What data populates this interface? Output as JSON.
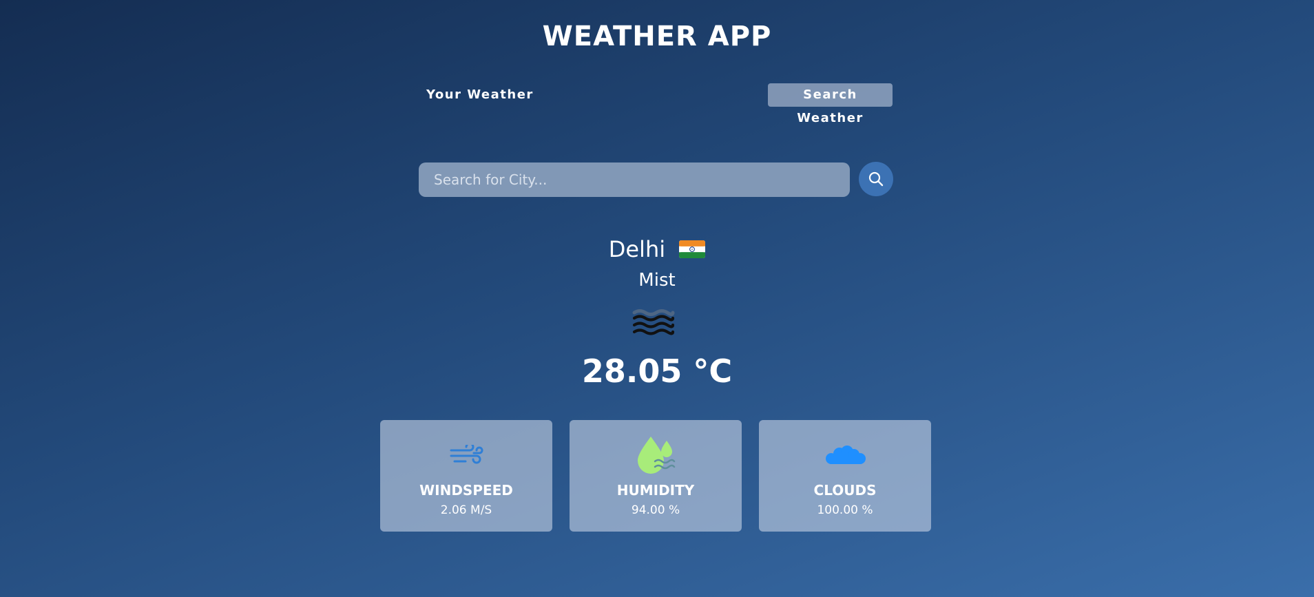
{
  "header": {
    "title": "WEATHER APP"
  },
  "tabs": [
    {
      "label": "Your Weather",
      "active": false
    },
    {
      "label": "Search Weather",
      "active": true
    }
  ],
  "search": {
    "value": "",
    "placeholder": "Search for City..."
  },
  "weather": {
    "city": "Delhi",
    "country_flag_icon": "india-flag-icon",
    "condition": "Mist",
    "condition_icon": "mist-icon",
    "temperature": "28.05 °C"
  },
  "stats": [
    {
      "icon": "wind-icon",
      "title": "WINDSPEED",
      "value": "2.06 M/S"
    },
    {
      "icon": "humidity-icon",
      "title": "HUMIDITY",
      "value": "94.00 %"
    },
    {
      "icon": "cloud-icon",
      "title": "CLOUDS",
      "value": "100.00 %"
    }
  ],
  "colors": {
    "search_button": "#3c72b4",
    "wind_icon": "#2f7fd6",
    "humidity_icon": "#a8ec7a",
    "cloud_icon": "#1f8fff"
  }
}
